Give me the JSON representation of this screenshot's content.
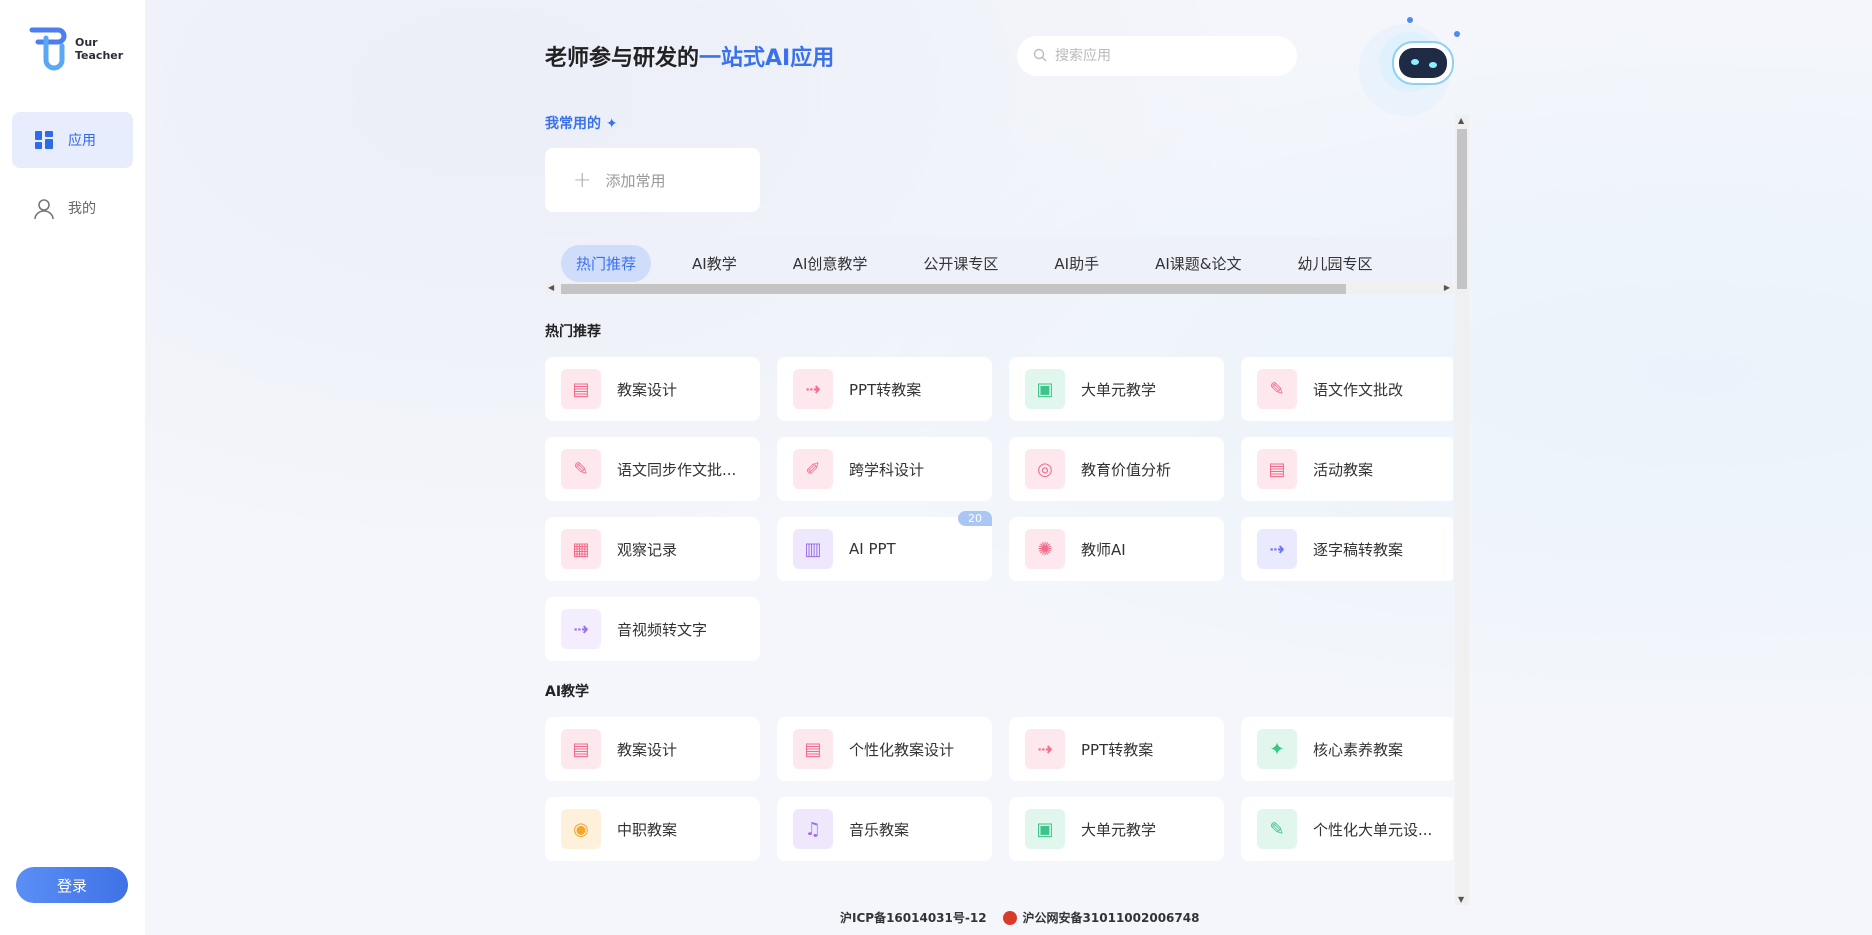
{
  "app": {
    "logo_line1": "Our",
    "logo_line2": "Teacher"
  },
  "sidebar": {
    "items": [
      {
        "label": "应用",
        "icon": "grid-icon"
      },
      {
        "label": "我的",
        "icon": "user-icon"
      }
    ],
    "login": "登录"
  },
  "header": {
    "title_plain": "老师参与研发的",
    "title_highlight": "一站式AI应用",
    "search_placeholder": "搜索应用"
  },
  "favorites": {
    "title": "我常用的",
    "add_label": "添加常用"
  },
  "tabs": [
    "热门推荐",
    "AI教学",
    "AI创意教学",
    "公开课专区",
    "AI助手",
    "AI课题&论文",
    "幼儿园专区"
  ],
  "sections": [
    {
      "title": "热门推荐",
      "items": [
        {
          "name": "教案设计",
          "icon": "clipboard-icon",
          "color": "#f36a8a",
          "bg": "#fde8ee"
        },
        {
          "name": "PPT转教案",
          "icon": "ppt-convert-icon",
          "color": "#f36a8a",
          "bg": "#fde8ee"
        },
        {
          "name": "大单元教学",
          "icon": "teacher-board-icon",
          "color": "#3cc58a",
          "bg": "#e1f6ec"
        },
        {
          "name": "语文作文批改",
          "icon": "essay-correct-icon",
          "color": "#f36a8a",
          "bg": "#fde8ee"
        },
        {
          "name": "语文同步作文批...",
          "icon": "sync-essay-icon",
          "color": "#f36a8a",
          "bg": "#fde8ee"
        },
        {
          "name": "跨学科设计",
          "icon": "pencil-ruler-icon",
          "color": "#f36a8a",
          "bg": "#fde8ee"
        },
        {
          "name": "教育价值分析",
          "icon": "target-analysis-icon",
          "color": "#f36a8a",
          "bg": "#fde8ee"
        },
        {
          "name": "活动教案",
          "icon": "clipboard-icon",
          "color": "#f36a8a",
          "bg": "#fde8ee"
        },
        {
          "name": "观察记录",
          "icon": "record-icon",
          "color": "#f36a8a",
          "bg": "#fde8ee"
        },
        {
          "name": "AI PPT",
          "icon": "ppt-file-icon",
          "color": "#9b6df0",
          "bg": "#efe8fd",
          "badge": "20"
        },
        {
          "name": "教师AI",
          "icon": "lightbulb-icon",
          "color": "#f36a8a",
          "bg": "#fde8ee"
        },
        {
          "name": "逐字稿转教案",
          "icon": "transcript-icon",
          "color": "#6b74f0",
          "bg": "#e9eafd"
        },
        {
          "name": "音视频转文字",
          "icon": "av-convert-icon",
          "color": "#9b6df0",
          "bg": "#f3edfd"
        }
      ]
    },
    {
      "title": "AI教学",
      "items": [
        {
          "name": "教案设计",
          "icon": "clipboard-icon",
          "color": "#f36a8a",
          "bg": "#fde8ee"
        },
        {
          "name": "个性化教案设计",
          "icon": "custom-plan-icon",
          "color": "#f36a8a",
          "bg": "#fde8ee"
        },
        {
          "name": "PPT转教案",
          "icon": "ppt-convert-icon",
          "color": "#f36a8a",
          "bg": "#fde8ee"
        },
        {
          "name": "核心素养教案",
          "icon": "core-literacy-icon",
          "color": "#3cc58a",
          "bg": "#e1f6ec"
        },
        {
          "name": "中职教案",
          "icon": "vocational-icon",
          "color": "#f0a82c",
          "bg": "#fdf1dc"
        },
        {
          "name": "音乐教案",
          "icon": "music-icon",
          "color": "#9b6df0",
          "bg": "#efe8fd"
        },
        {
          "name": "大单元教学",
          "icon": "teacher-board-icon",
          "color": "#3cc58a",
          "bg": "#e1f6ec"
        },
        {
          "name": "个性化大单元设...",
          "icon": "custom-unit-icon",
          "color": "#3cc58a",
          "bg": "#e1f6ec"
        }
      ]
    }
  ],
  "footer": {
    "icp": "沪ICP备16014031号-12",
    "police": "沪公网安备31011002006748"
  }
}
